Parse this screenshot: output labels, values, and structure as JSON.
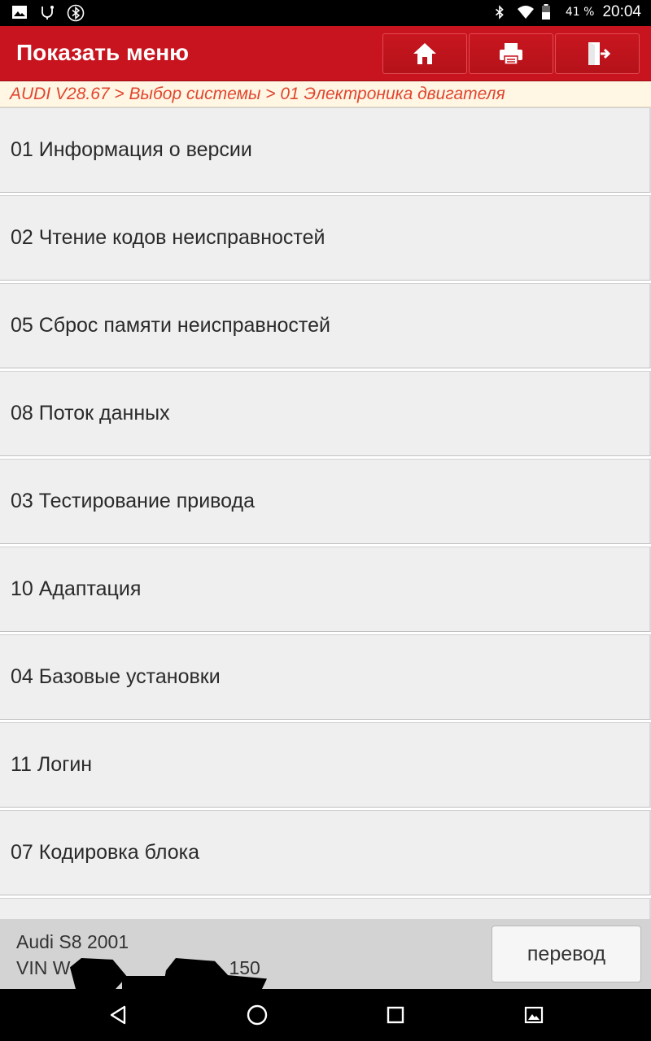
{
  "status_bar": {
    "battery_percent": "41 %",
    "time": "20:04",
    "icons": [
      "image-icon",
      "usb-debug-icon",
      "bluetooth-badge-icon",
      "bluetooth-icon",
      "wifi-icon",
      "battery-icon"
    ]
  },
  "header": {
    "title": "Показать меню",
    "buttons": [
      "home-icon",
      "print-icon",
      "exit-icon"
    ],
    "background_color": "#c8141e"
  },
  "breadcrumb": {
    "text": "AUDI V28.67 > Выбор системы > 01 Электроника двигателя",
    "color": "#e0462f"
  },
  "menu": {
    "items": [
      {
        "label": "01 Информация о версии"
      },
      {
        "label": "02 Чтение кодов неисправностей"
      },
      {
        "label": "05 Сброс памяти неисправностей"
      },
      {
        "label": "08 Поток данных"
      },
      {
        "label": "03 Тестирование привода"
      },
      {
        "label": "10 Адаптация"
      },
      {
        "label": "04 Базовые установки"
      },
      {
        "label": "11 Логин"
      },
      {
        "label": "07 Кодировка блока"
      }
    ]
  },
  "footer": {
    "vehicle_model": "Audi S8 2001",
    "vin_prefix": "VIN W",
    "vin_suffix": "150",
    "translate_label": "перевод"
  },
  "nav_bar": {
    "buttons": [
      "back-icon",
      "home-circle-icon",
      "recents-icon",
      "screenshot-icon"
    ]
  }
}
